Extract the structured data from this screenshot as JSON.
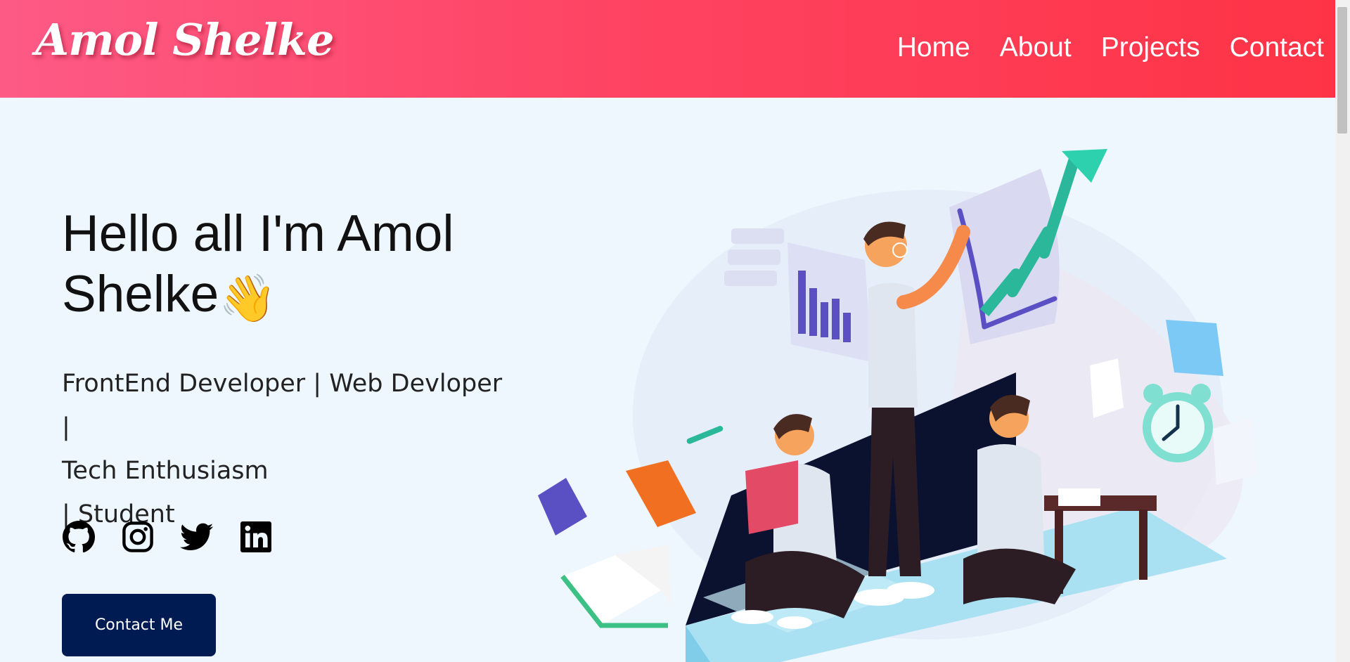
{
  "header": {
    "logo": "Amol Shelke",
    "nav": [
      "Home",
      "About",
      "Projects",
      "Contact"
    ]
  },
  "hero": {
    "title": "Hello all I'm Amol Shelke",
    "wave_emoji": "👋",
    "subtitle_line1": "FrontEnd Developer | Web Devloper |",
    "subtitle_line2": "Tech Enthusiasm",
    "subtitle_line3": "| Student",
    "contact_button": "Contact Me"
  },
  "socials": [
    "github-icon",
    "instagram-icon",
    "twitter-icon",
    "linkedin-icon"
  ],
  "colors": {
    "header_start": "#fd5a86",
    "header_end": "#fe3346",
    "background": "#eef6fe",
    "button": "#001a52"
  }
}
